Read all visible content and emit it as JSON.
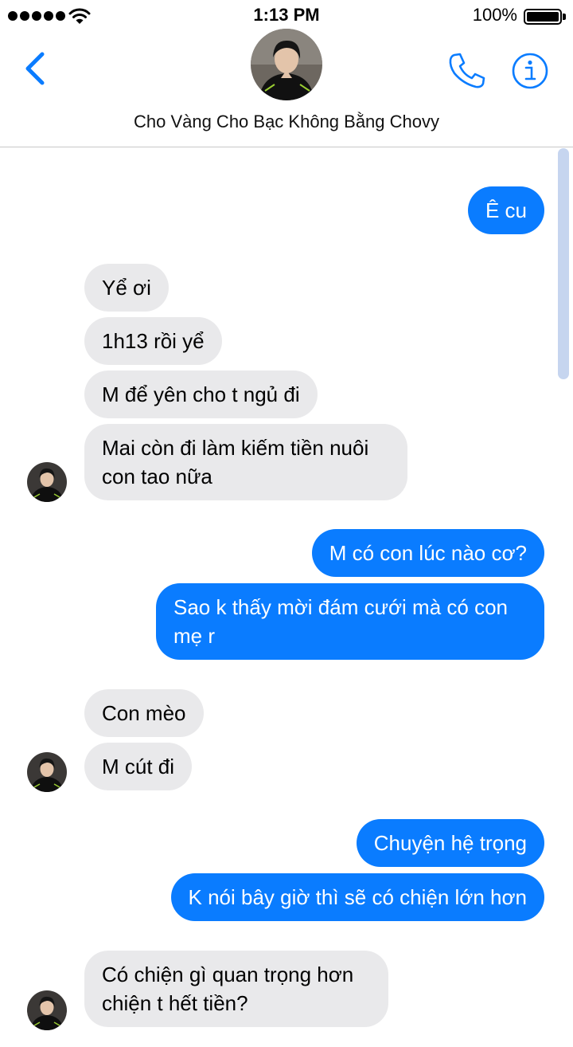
{
  "status_bar": {
    "time": "1:13 PM",
    "battery": "100%"
  },
  "header": {
    "contact_name": "Cho Vàng Cho Bạc Không Bằng Chovy"
  },
  "colors": {
    "accent": "#0a7cff",
    "outgoing_bubble": "#0a7cff",
    "incoming_bubble": "#e9e9eb"
  },
  "icons": {
    "back": "chevron-left-icon",
    "call": "phone-icon",
    "info": "info-icon"
  },
  "messages": [
    {
      "from": "me",
      "text": "Ê cu"
    },
    {
      "from": "them",
      "text": "Yể ơi"
    },
    {
      "from": "them",
      "text": "1h13 rồi yể"
    },
    {
      "from": "them",
      "text": "M để yên cho t ngủ đi"
    },
    {
      "from": "them",
      "text": "Mai còn đi làm kiếm tiền nuôi con tao nữa"
    },
    {
      "from": "me",
      "text": "M có con lúc nào cơ?"
    },
    {
      "from": "me",
      "text": "Sao k thấy mời đám cưới mà có con mẹ r"
    },
    {
      "from": "them",
      "text": "Con mèo"
    },
    {
      "from": "them",
      "text": "M cút đi"
    },
    {
      "from": "me",
      "text": "Chuyện hệ trọng"
    },
    {
      "from": "me",
      "text": "K nói bây giờ thì sẽ có chiện lớn hơn"
    },
    {
      "from": "them",
      "text": "Có chiện gì quan trọng hơn chiện t hết tiền?"
    }
  ]
}
